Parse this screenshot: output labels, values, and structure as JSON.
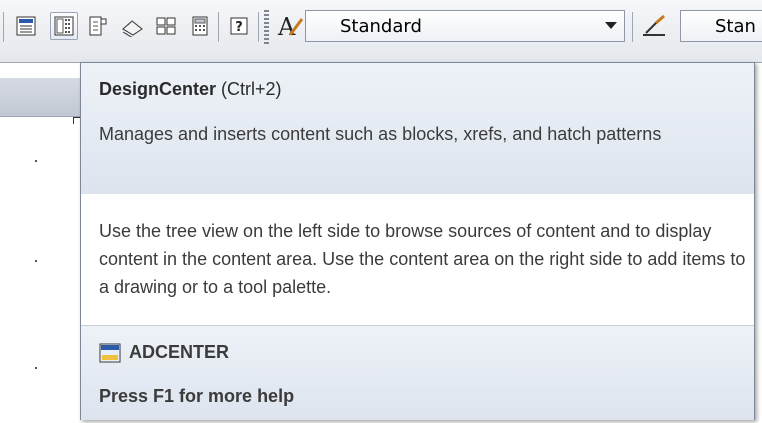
{
  "toolbar": {
    "buttons": [
      {
        "name": "properties-icon"
      },
      {
        "name": "designcenter-icon"
      },
      {
        "name": "tool-palettes-icon"
      },
      {
        "name": "sheet-set-manager-icon"
      },
      {
        "name": "markup-set-manager-icon"
      },
      {
        "name": "quickcalc-icon"
      },
      {
        "name": "help-icon"
      }
    ],
    "text_style_label": "Standard",
    "dim_style_label": "Stan"
  },
  "tooltip": {
    "title": "DesignCenter",
    "shortcut": "(Ctrl+2)",
    "description": "Manages and inserts content such as blocks, xrefs, and hatch patterns",
    "details": "Use the tree view on the left side to browse sources of content and to display content in the content area. Use the content area on the right side to add items to a drawing or to a tool palette.",
    "command": "ADCENTER",
    "help_text": "Press F1 for more help"
  },
  "colors": {
    "accent_blue": "#2a5aa8",
    "tooltip_border": "#7d8796"
  }
}
